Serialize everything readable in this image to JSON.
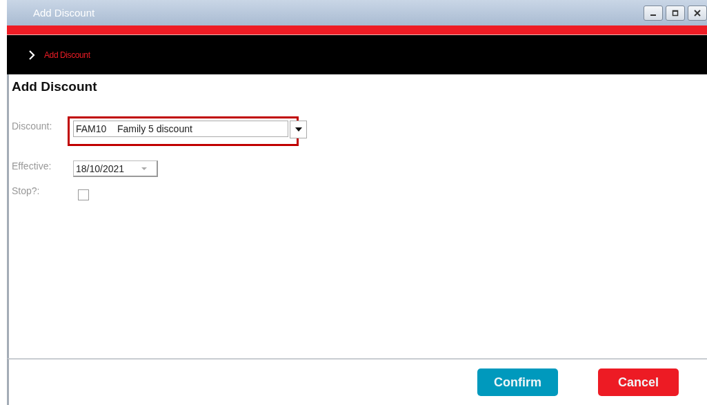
{
  "window": {
    "title": "Add Discount"
  },
  "breadcrumb": {
    "label": "Add Discount"
  },
  "heading": "Add Discount",
  "form": {
    "discount": {
      "label": "Discount:",
      "value": "FAM10    Family 5 discount",
      "highlighted": true
    },
    "effective": {
      "label": "Effective:",
      "value": "18/10/2021"
    },
    "stop": {
      "label": "Stop?:",
      "checked": false
    }
  },
  "buttons": [
    {
      "label": "Confirm",
      "kind": "primary"
    },
    {
      "label": "Cancel",
      "kind": "danger"
    }
  ]
}
